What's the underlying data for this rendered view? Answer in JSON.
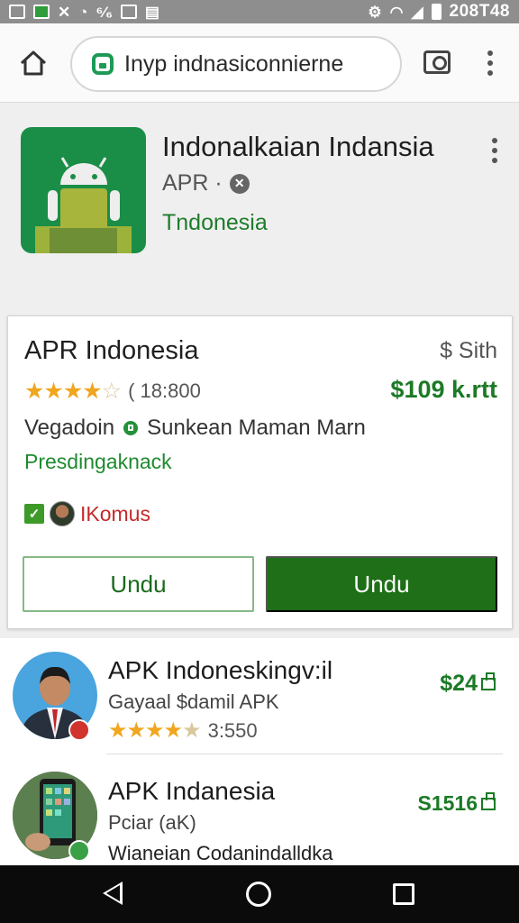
{
  "status_bar": {
    "time": "208T48",
    "left_icons": [
      "mail-icon",
      "app-icon",
      "missed-call-icon",
      "alarm-icon",
      "data-icon",
      "photo-icon",
      "storage-icon"
    ],
    "right_icons": [
      "alarm-clock-icon",
      "wifi-icon",
      "signal-icon",
      "battery-icon"
    ]
  },
  "browser": {
    "url": "Inyp indnasiconnierne"
  },
  "app_header": {
    "title": "Indonalkaian Indansia",
    "subtitle": "APR ·",
    "country": "Tndonesia"
  },
  "card": {
    "title": "APR Indonesia",
    "size": "$ Sith",
    "rating_count": "( 18:800",
    "price": "$109 k.rtt",
    "developer_a": "Vegadoin",
    "developer_b": "Sunkean  Maman Marn",
    "category": "Presdingaknack",
    "tag": "IKomus",
    "button_secondary": "Undu",
    "button_primary": "Undu"
  },
  "list": [
    {
      "title": "APK Indoneskingv:il",
      "subtitle": "Gayaal $damil APK",
      "rating_count": "3:550",
      "price": "$24"
    },
    {
      "title": "APK Indanesia",
      "subtitle": "Pciar (aK)",
      "line3": "Wianeian Codanindalldka",
      "price": "S1516"
    }
  ],
  "colors": {
    "accent_green": "#1e6f18",
    "price_green": "#1b7a25",
    "star": "#f0a61e",
    "tag_red": "#c62a2a"
  }
}
